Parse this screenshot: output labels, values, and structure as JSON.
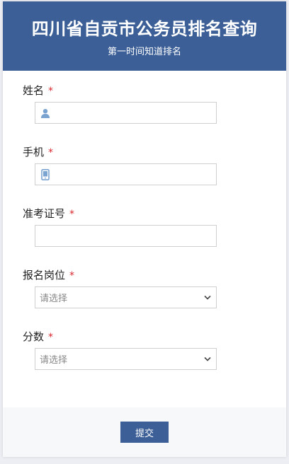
{
  "header": {
    "title": "四川省自贡市公务员排名查询",
    "subtitle": "第一时间知道排名"
  },
  "form": {
    "name": {
      "label": "姓名",
      "required": "*",
      "value": "",
      "icon": "user-icon"
    },
    "phone": {
      "label": "手机",
      "required": "*",
      "value": "",
      "icon": "mobile-phone-icon"
    },
    "ticket": {
      "label": "准考证号",
      "required": "*",
      "value": ""
    },
    "position": {
      "label": "报名岗位",
      "required": "*",
      "selected": "请选择"
    },
    "score": {
      "label": "分数",
      "required": "*",
      "selected": "请选择"
    }
  },
  "footer": {
    "submit_label": "提交"
  },
  "colors": {
    "brand": "#3b5f96",
    "required": "#d9292f",
    "icon": "#7aa3d0"
  }
}
